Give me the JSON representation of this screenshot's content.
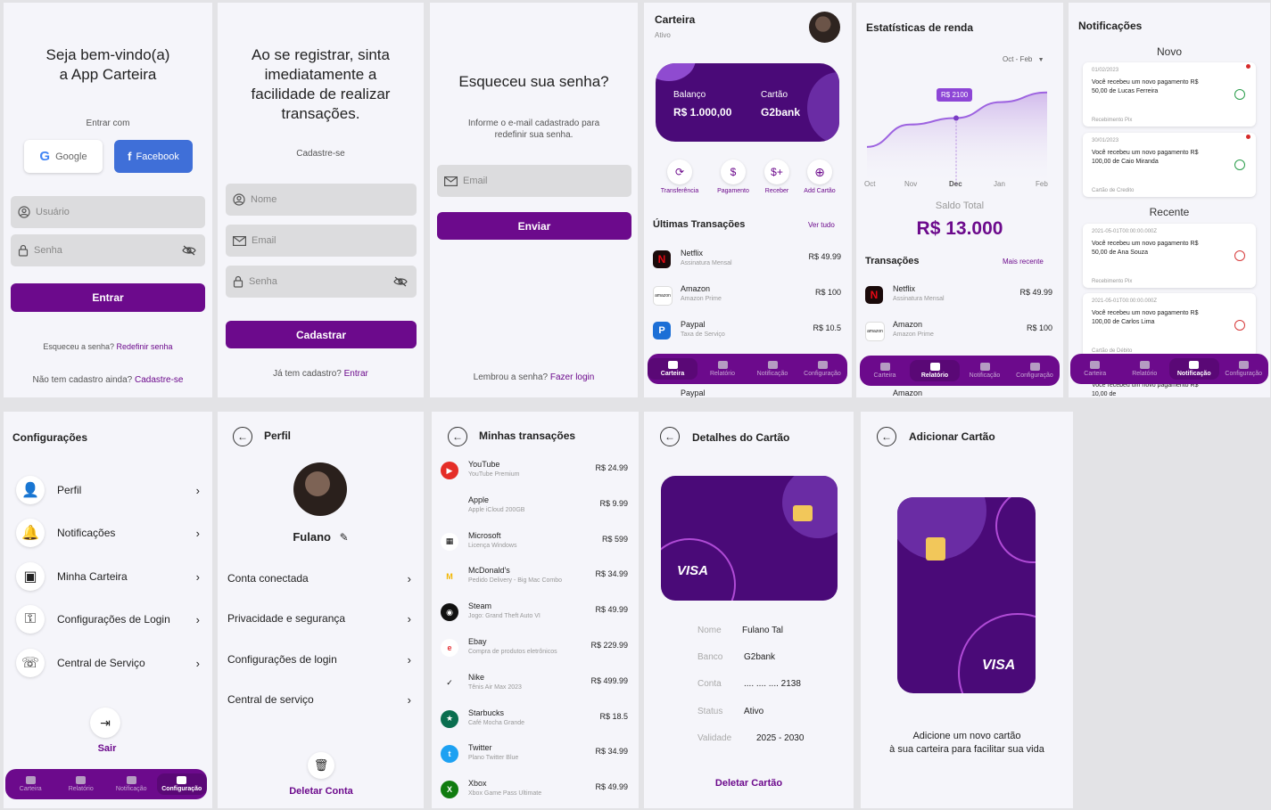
{
  "login": {
    "title_line1": "Seja bem-vindo(a)",
    "title_line2": "a App Carteira",
    "enter_with": "Entrar com",
    "google": "Google",
    "facebook": "Facebook",
    "user_placeholder": "Usuário",
    "pass_placeholder": "Senha",
    "enter_button": "Entrar",
    "forgot_text": "Esqueceu a senha?",
    "forgot_link": "Redefinir senha",
    "no_account": "Não tem cadastro ainda?",
    "signup_link": "Cadastre-se"
  },
  "register": {
    "title_line1": "Ao se registrar, sinta",
    "title_line2": "imediatamente a",
    "title_line3": "facilidade de realizar",
    "title_line4": "transações.",
    "subtitle": "Cadastre-se",
    "name_placeholder": "Nome",
    "email_placeholder": "Email",
    "pass_placeholder": "Senha",
    "button": "Cadastrar",
    "already": "Já tem cadastro?",
    "login_link": "Entrar"
  },
  "forgot": {
    "title": "Esqueceu sua senha?",
    "desc_line1": "Informe o e-mail cadastrado para",
    "desc_line2": "redefinir sua senha.",
    "email_placeholder": "Email",
    "button": "Enviar",
    "remember": "Lembrou a senha?",
    "login_link": "Fazer login"
  },
  "wallet": {
    "title": "Carteira",
    "status": "Ativo",
    "balance_label": "Balanço",
    "balance_value": "R$ 1.000,00",
    "card_label": "Cartão",
    "card_value": "G2bank",
    "actions": [
      "Transferência",
      "Pagamento",
      "Receber",
      "Add Cartão"
    ],
    "last_tx": "Últimas Transações",
    "see_all": "Ver tudo",
    "transactions": [
      {
        "name": "Netflix",
        "desc": "Assinatura Mensal",
        "amount": "R$ 49.99"
      },
      {
        "name": "Amazon",
        "desc": "Amazon Prime",
        "amount": "R$ 100"
      },
      {
        "name": "Paypal",
        "desc": "Taxa de Serviço",
        "amount": "R$ 10.5"
      }
    ],
    "peek": "Paypal"
  },
  "stats": {
    "title": "Estatísticas de renda",
    "range": "Oct - Feb",
    "tooltip": "R$ 2100",
    "months": [
      "Oct",
      "Nov",
      "Dec",
      "Jan",
      "Feb"
    ],
    "total_label": "Saldo Total",
    "total_value": "R$ 13.000",
    "tx_title": "Transações",
    "more_recent": "Mais recente",
    "transactions": [
      {
        "name": "Netflix",
        "desc": "Assinatura Mensal",
        "amount": "R$ 49.99"
      },
      {
        "name": "Amazon",
        "desc": "Amazon Prime",
        "amount": "R$ 100"
      }
    ],
    "peek": "Amazon",
    "chart_data": {
      "type": "area",
      "x": [
        "Oct",
        "Nov",
        "Dec",
        "Jan",
        "Feb"
      ],
      "values": [
        1200,
        1900,
        2100,
        2600,
        2900
      ]
    }
  },
  "notifications": {
    "title": "Notificações",
    "new_label": "Novo",
    "recent_label": "Recente",
    "items": [
      {
        "date": "01/02/2023",
        "text": "Você recebeu um novo pagamento R$ 50,00 de Lucas Ferreira",
        "source": "Recebimento Pix",
        "color": "#2a9d4b"
      },
      {
        "date": "30/01/2023",
        "text": "Você recebeu um novo pagamento R$ 100,00 de Caio Miranda",
        "source": "Cartão de Credito",
        "color": "#2a9d4b"
      },
      {
        "date": "2021-05-01T00:00:00.000Z",
        "text": "Você recebeu um novo pagamento R$ 50,00 de Ana Souza",
        "source": "Recebimento Pix",
        "color": "#d63a3a"
      },
      {
        "date": "2021-05-01T00:00:00.000Z",
        "text": "Você recebeu um novo pagamento R$ 100,00 de Carlos Lima",
        "source": "Cartão de Débito",
        "color": "#d63a3a"
      }
    ],
    "peek": "Você recebeu um novo pagamento R$ 10,00 de"
  },
  "nav": {
    "labels": [
      "Carteira",
      "Relatório",
      "Notificação",
      "Configuração"
    ]
  },
  "settings": {
    "title": "Configurações",
    "items": [
      "Perfil",
      "Notificações",
      "Minha Carteira",
      "Configurações de Login",
      "Central de Serviço"
    ],
    "logout": "Sair"
  },
  "profile": {
    "title": "Perfil",
    "name": "Fulano",
    "items": [
      "Conta conectada",
      "Privacidade e segurança",
      "Configurações de login",
      "Central de serviço"
    ],
    "delete": "Deletar Conta"
  },
  "my_tx": {
    "title": "Minhas transações",
    "items": [
      {
        "name": "YouTube",
        "desc": "YouTube Premium",
        "amount": "R$ 24.99"
      },
      {
        "name": "Apple",
        "desc": "Apple iCloud 200GB",
        "amount": "R$ 9.99"
      },
      {
        "name": "Microsoft",
        "desc": "Licença Windows",
        "amount": "R$ 599"
      },
      {
        "name": "McDonald's",
        "desc": "Pedido Delivery - Big Mac Combo",
        "amount": "R$ 34.99"
      },
      {
        "name": "Steam",
        "desc": "Jogo: Grand Theft Auto VI",
        "amount": "R$ 49.99"
      },
      {
        "name": "Ebay",
        "desc": "Compra de produtos eletrônicos",
        "amount": "R$ 229.99"
      },
      {
        "name": "Nike",
        "desc": "Tênis Air Max 2023",
        "amount": "R$ 499.99"
      },
      {
        "name": "Starbucks",
        "desc": "Café Mocha Grande",
        "amount": "R$ 18.5"
      },
      {
        "name": "Twitter",
        "desc": "Plano Twitter Blue",
        "amount": "R$ 34.99"
      },
      {
        "name": "Xbox",
        "desc": "Xbox Game Pass Ultimate",
        "amount": "R$ 49.99"
      }
    ]
  },
  "card_details": {
    "title": "Detalhes do Cartão",
    "brand": "VISA",
    "labels": [
      "Nome",
      "Banco",
      "Conta",
      "Status",
      "Validade"
    ],
    "values": [
      "Fulano Tal",
      "G2bank",
      ".... .... .... 2138",
      "Ativo",
      "2025 - 2030"
    ],
    "delete": "Deletar Cartão"
  },
  "add_card": {
    "title": "Adicionar Cartão",
    "brand": "VISA",
    "line1": "Adicione um novo cartão",
    "line2": "à sua carteira para facilitar sua vida"
  }
}
